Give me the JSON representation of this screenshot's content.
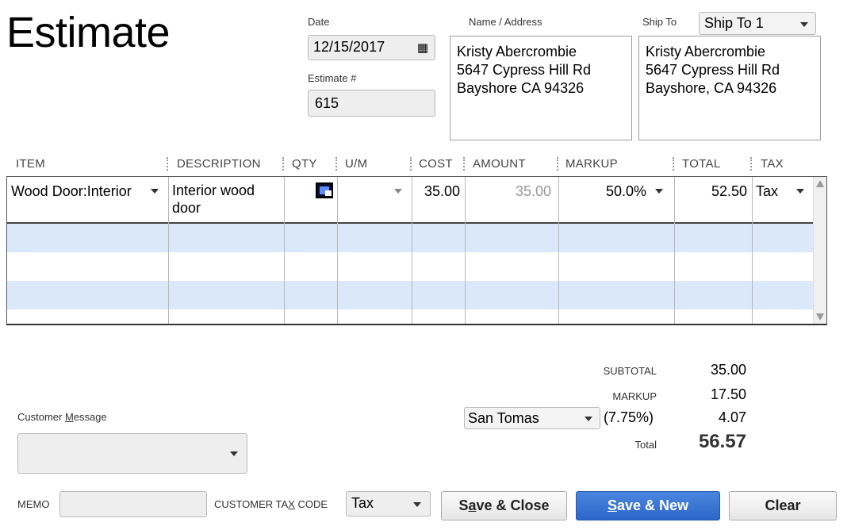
{
  "header": {
    "title": "Estimate",
    "date_label": "Date",
    "date_value": "12/15/2017",
    "estimate_no_label": "Estimate #",
    "estimate_no_value": "615",
    "name_address_label": "Name / Address",
    "name_address_lines": [
      "Kristy Abercrombie",
      "5647 Cypress Hill Rd",
      "Bayshore CA 94326"
    ],
    "ship_to_label": "Ship To",
    "ship_to_selected": "Ship To 1",
    "ship_to_lines": [
      "Kristy Abercrombie",
      "5647 Cypress Hill Rd",
      "Bayshore, CA 94326"
    ]
  },
  "table": {
    "columns": [
      "ITEM",
      "DESCRIPTION",
      "QTY",
      "U/M",
      "COST",
      "AMOUNT",
      "MARKUP",
      "TOTAL",
      "TAX"
    ],
    "rows": [
      {
        "item": "Wood Door:Interior",
        "description_line1": "Interior wood",
        "description_line2": "door",
        "qty": "",
        "um": "",
        "cost": "35.00",
        "amount": "35.00",
        "markup": "50.0%",
        "total": "52.50",
        "tax": "Tax"
      }
    ]
  },
  "totals": {
    "subtotal_label": "SUBTOTAL",
    "subtotal_value": "35.00",
    "markup_label": "MARKUP",
    "markup_value": "17.50",
    "tax_item": "San Tomas",
    "tax_rate": "(7.75%)",
    "tax_value": "4.07",
    "total_label": "Total",
    "total_value": "56.57"
  },
  "footer": {
    "customer_message_label_pre": "Customer ",
    "customer_message_label_u": "M",
    "customer_message_label_post": "essage",
    "memo_label": "MEMO",
    "customer_tax_code_label_pre": "CUSTOMER TA",
    "customer_tax_code_label_u": "X",
    "customer_tax_code_label_post": " CODE",
    "customer_tax_code_value": "Tax",
    "save_close_pre": "S",
    "save_close_u": "a",
    "save_close_post": "ve & Close",
    "save_new_u": "S",
    "save_new_post": "ave & New",
    "clear_label": "Clear"
  },
  "colors": {
    "accent": "#2d67c8",
    "row_alt": "#dbe8fa"
  }
}
